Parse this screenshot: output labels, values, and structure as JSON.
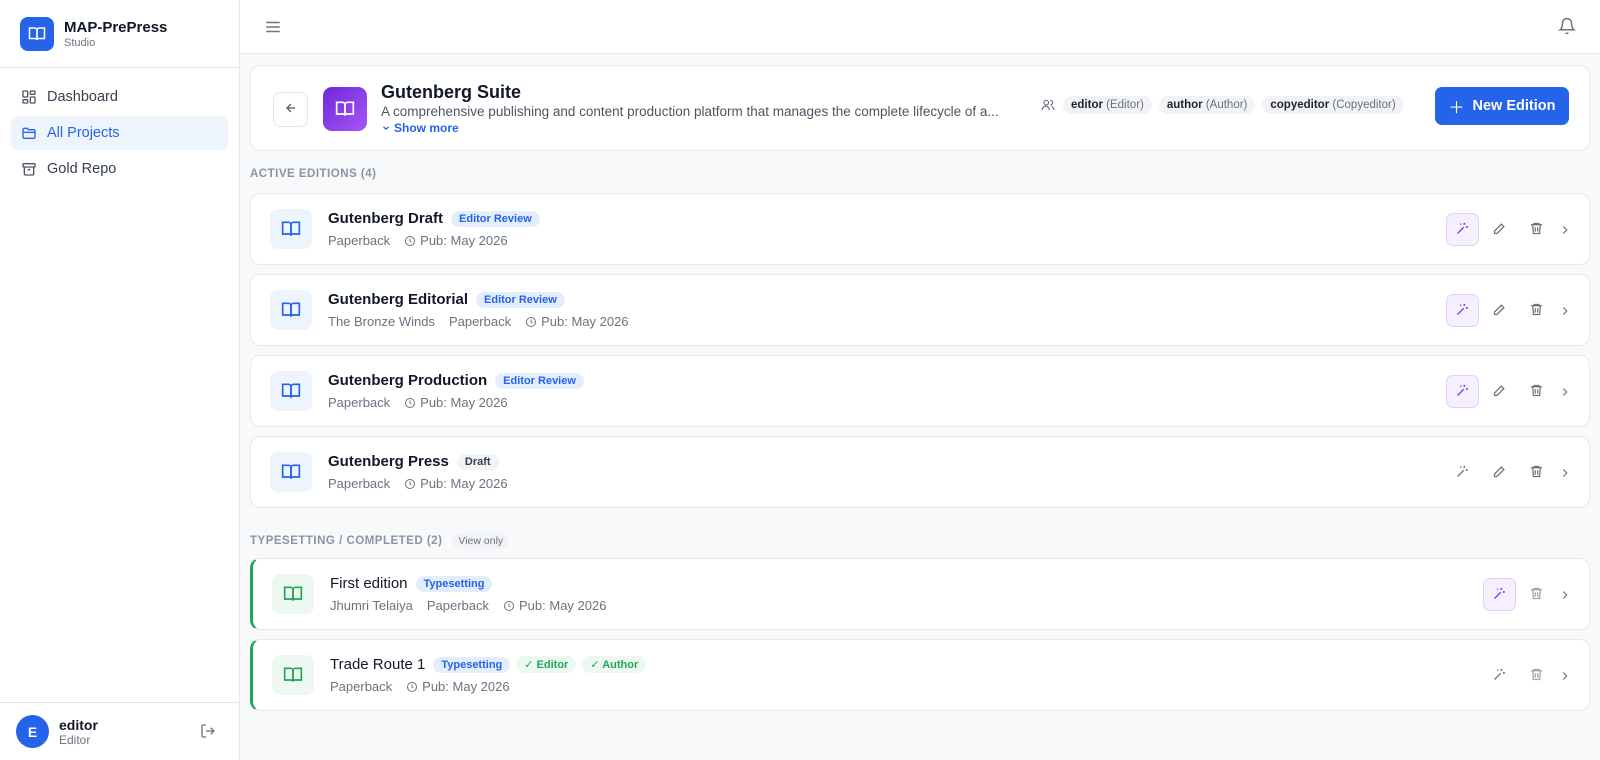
{
  "app": {
    "name": "MAP-PrePress",
    "subtitle": "Studio"
  },
  "sidebar": {
    "items": [
      {
        "label": "Dashboard",
        "icon": "dashboard-icon",
        "active": false
      },
      {
        "label": "All Projects",
        "icon": "folder-icon",
        "active": true
      },
      {
        "label": "Gold Repo",
        "icon": "archive-icon",
        "active": false
      }
    ],
    "user": {
      "initial": "E",
      "name": "editor",
      "role": "Editor"
    }
  },
  "project": {
    "title": "Gutenberg Suite",
    "description": "A comprehensive publishing and content production platform that manages the complete lifecycle of a...",
    "show_more": "Show more",
    "members": [
      {
        "name": "editor",
        "role": "(Editor)"
      },
      {
        "name": "author",
        "role": "(Author)"
      },
      {
        "name": "copyeditor",
        "role": "(Copyeditor)"
      }
    ],
    "new_button": "New Edition"
  },
  "active_section": {
    "label": "ACTIVE EDITIONS (4)"
  },
  "active_editions": [
    {
      "name": "Gutenberg Draft",
      "badge": "Editor Review",
      "meta": [
        "Paperback"
      ],
      "pub": "Pub: May 2026"
    },
    {
      "name": "Gutenberg Editorial",
      "badge": "Editor Review",
      "meta": [
        "The Bronze Winds",
        "Paperback"
      ],
      "pub": "Pub: May 2026"
    },
    {
      "name": "Gutenberg Production",
      "badge": "Editor Review",
      "meta": [
        "Paperback"
      ],
      "pub": "Pub: May 2026"
    },
    {
      "name": "Gutenberg Press",
      "badge": "Draft",
      "meta": [
        "Paperback"
      ],
      "pub": "Pub: May 2026"
    }
  ],
  "completed_section": {
    "label": "TYPESETTING / COMPLETED (2)",
    "tag": "View only"
  },
  "completed_editions": [
    {
      "name": "First edition",
      "badge": "Typesetting",
      "meta": [
        "Jhumri Telaiya",
        "Paperback"
      ],
      "pub": "Pub: May 2026"
    },
    {
      "name": "Trade Route 1",
      "badge": "Typesetting",
      "checks": [
        "✓ Editor",
        "✓ Author"
      ],
      "meta": [
        "Paperback"
      ],
      "pub": "Pub: May 2026"
    }
  ],
  "colors": {
    "accent": "#2563eb",
    "success": "#22a558",
    "purple": "#7c3aed"
  }
}
